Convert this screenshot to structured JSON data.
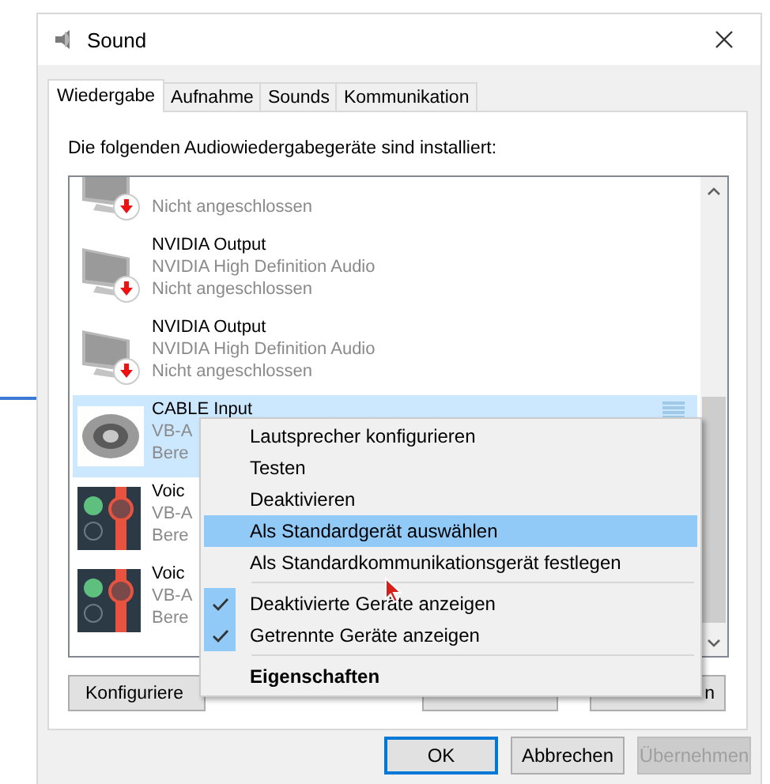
{
  "window": {
    "title": "Sound"
  },
  "tabs": [
    {
      "label": "Wiedergabe",
      "selected": true
    },
    {
      "label": "Aufnahme",
      "selected": false
    },
    {
      "label": "Sounds",
      "selected": false
    },
    {
      "label": "Kommunikation",
      "selected": false
    }
  ],
  "instruction": "Die folgenden Audiowiedergabegeräte sind installiert:",
  "devices": [
    {
      "kind": "monitor",
      "lines": [
        "Nicht angeschlossen"
      ],
      "selected": false
    },
    {
      "kind": "monitor",
      "name": "NVIDIA Output",
      "lines": [
        "NVIDIA High Definition Audio",
        "Nicht angeschlossen"
      ],
      "selected": false
    },
    {
      "kind": "monitor",
      "name": "NVIDIA Output",
      "lines": [
        "NVIDIA High Definition Audio",
        "Nicht angeschlossen"
      ],
      "selected": false
    },
    {
      "kind": "cable",
      "name": "CABLE Input",
      "lines": [
        "VB-A",
        "Bere"
      ],
      "selected": true
    },
    {
      "kind": "mixer",
      "name": "Voic",
      "lines": [
        "VB-A",
        "Bere"
      ],
      "selected": false
    },
    {
      "kind": "mixer",
      "name": "Voic",
      "lines": [
        "VB-A",
        "Bere"
      ],
      "selected": false
    }
  ],
  "device_buttons": [
    "Konfiguriere",
    "n"
  ],
  "context_menu": {
    "items": [
      {
        "kind": "item",
        "label": "Lautsprecher konfigurieren",
        "highlighted": false,
        "default": false
      },
      {
        "kind": "item",
        "label": "Testen",
        "highlighted": false,
        "default": false
      },
      {
        "kind": "item",
        "label": "Deaktivieren",
        "highlighted": false,
        "default": false
      },
      {
        "kind": "item",
        "label": "Als Standardgerät auswählen",
        "highlighted": true,
        "default": false
      },
      {
        "kind": "item",
        "label": "Als Standardkommunikationsgerät festlegen",
        "highlighted": false,
        "default": false
      },
      {
        "kind": "separator"
      },
      {
        "kind": "check",
        "label": "Deaktivierte Geräte anzeigen",
        "checked": true
      },
      {
        "kind": "check",
        "label": "Getrennte Geräte anzeigen",
        "checked": true
      },
      {
        "kind": "separator"
      },
      {
        "kind": "item",
        "label": "Eigenschaften",
        "highlighted": false,
        "default": true
      }
    ]
  },
  "dialog_buttons": [
    {
      "label": "OK",
      "default": true,
      "disabled": false
    },
    {
      "label": "Abbrechen",
      "default": false,
      "disabled": false
    },
    {
      "label": "Übernehmen",
      "default": false,
      "disabled": true
    }
  ]
}
